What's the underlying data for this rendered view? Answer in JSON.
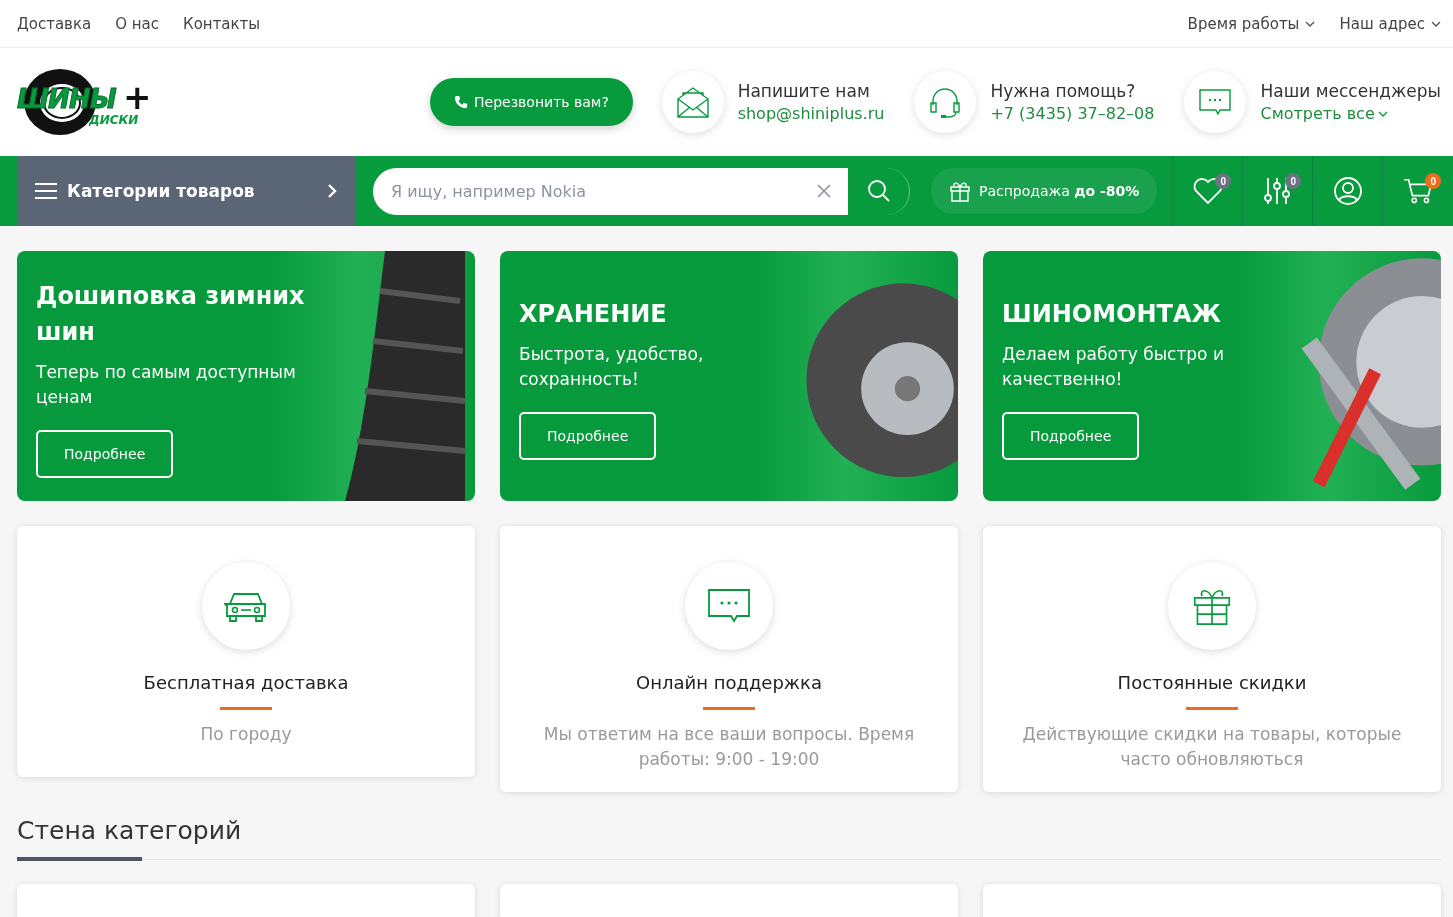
{
  "top_nav": {
    "links": [
      "Доставка",
      "О нас",
      "Контакты"
    ],
    "dropdowns": [
      "Время работы",
      "Наш адрес"
    ]
  },
  "header": {
    "logo": {
      "main": "ШИНЫ",
      "plus": "+",
      "sub": "ДИСКИ"
    },
    "callback_button": "Перезвонить вам?",
    "contacts": [
      {
        "kind": "mail",
        "title": "Напишите нам",
        "value": "shop@shiniplus.ru",
        "dropdown": false
      },
      {
        "kind": "headset",
        "title": "Нужна помощь?",
        "value": "+7 (3435) 37–82–08",
        "dropdown": false
      },
      {
        "kind": "chat",
        "title": "Наши мессенджеры",
        "value": "Смотреть все",
        "dropdown": true
      }
    ]
  },
  "navbar": {
    "categories": "Категории товаров",
    "search": {
      "placeholder": "Я ищу, например Nokia"
    },
    "sale": "Распродажа **до -80%**",
    "icons": [
      {
        "kind": "heart",
        "badge": "0",
        "color": "#6b7280"
      },
      {
        "kind": "compare",
        "badge": "0",
        "color": "#6b7280"
      },
      {
        "kind": "user"
      },
      {
        "kind": "cart",
        "badge": "0",
        "color": "#f26b1d"
      }
    ]
  },
  "promos": [
    {
      "kind": "tire",
      "title": "Дошиповка зимних шин",
      "text": "Теперь по самым доступным ценам",
      "button": "Подробнее"
    },
    {
      "kind": "cover",
      "title": "ХРАНЕНИЕ",
      "text": "Быстрота, удобство, сохранность!",
      "button": "Подробнее"
    },
    {
      "kind": "tools",
      "title": "ШИНОМОНТАЖ",
      "text": "Делаем работу быстро и качественно!",
      "button": "Подробнее"
    }
  ],
  "features": [
    {
      "kind": "car",
      "title": "Бесплатная доставка",
      "text": "По городу"
    },
    {
      "kind": "chat",
      "title": "Онлайн поддержка",
      "text": "Мы ответим на все ваши вопросы. Время работы: 9:00 - 19:00"
    },
    {
      "kind": "gift",
      "title": "Постоянные скидки",
      "text": "Действующие скидки на товары, которые часто обновляються"
    }
  ],
  "section_title": "Стена категорий"
}
